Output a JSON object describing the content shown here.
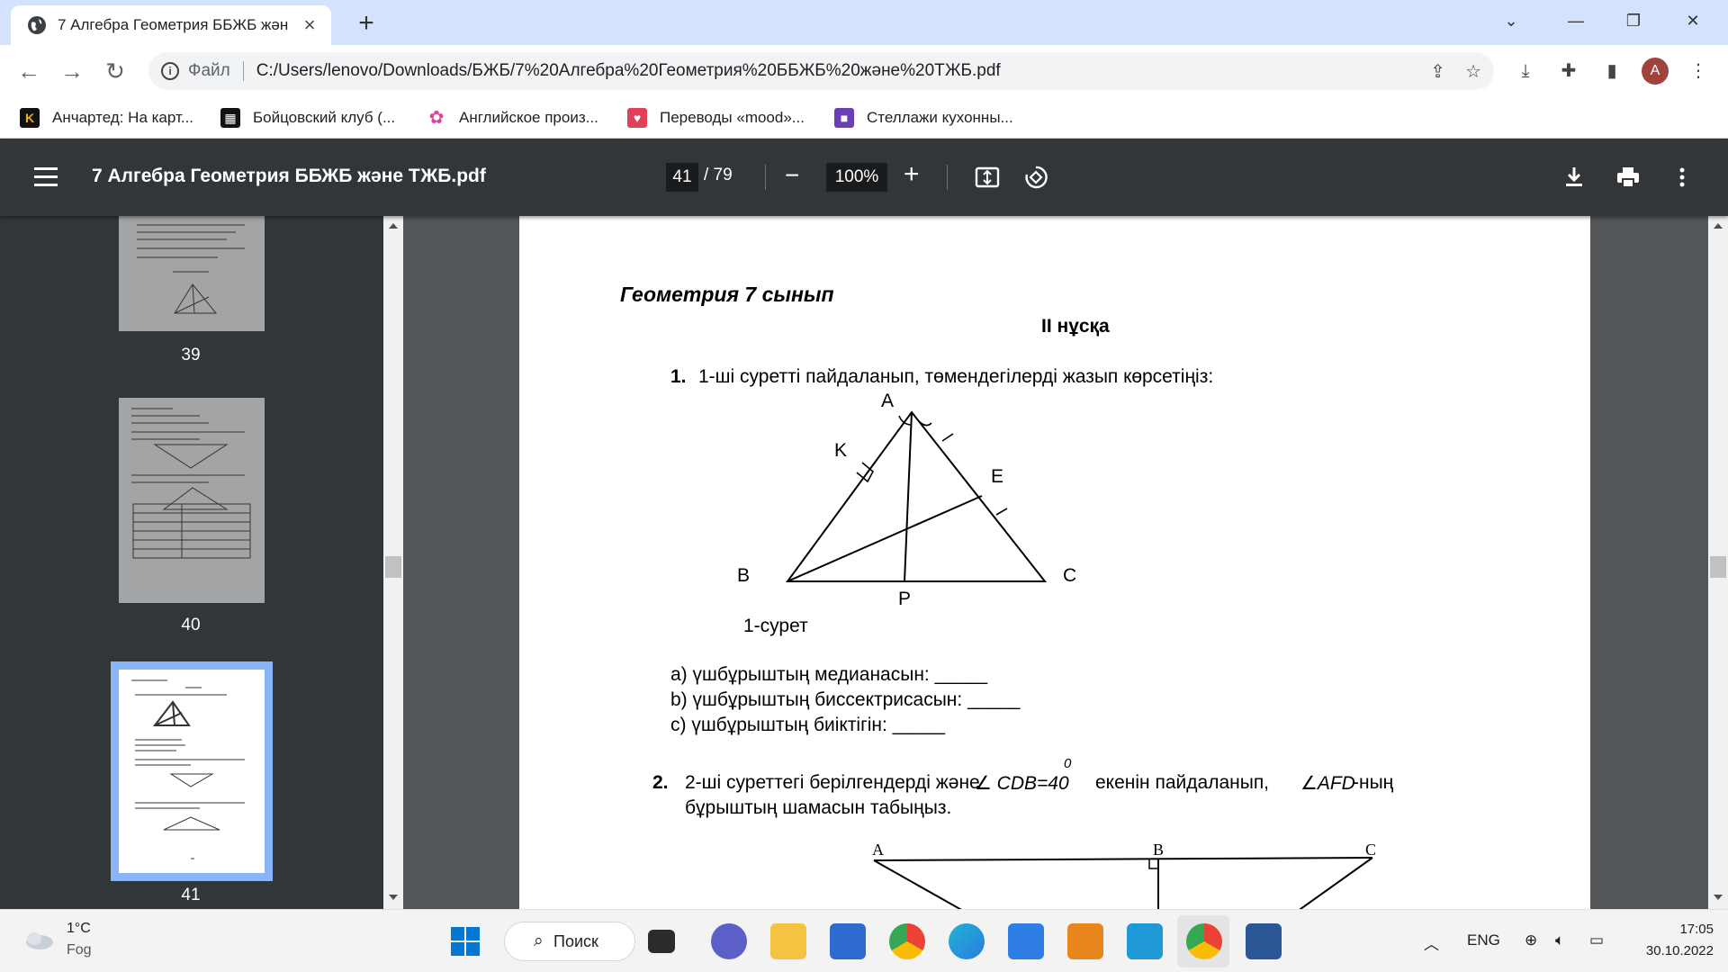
{
  "browser": {
    "tab_title": "7 Алгебра Геометрия ББЖБ жән",
    "url_prefix": "Файл",
    "url": "C:/Users/lenovo/Downloads/БЖБ/7%20Алгебра%20Геометрия%20ББЖБ%20және%20ТЖБ.pdf",
    "avatar_letter": "A",
    "bookmarks": [
      {
        "label": "Анчартед: На карт...",
        "icon": "K",
        "color": "#111111"
      },
      {
        "label": "Бойцовский клуб (...",
        "icon": "film-icon",
        "color": "#111111"
      },
      {
        "label": "Английское произ...",
        "icon": "pinwheel-icon",
        "color": "#e040a0"
      },
      {
        "label": "Переводы «mood»...",
        "icon": "bookmark-red-icon",
        "color": "#e0405a"
      },
      {
        "label": "Стеллажи кухонны...",
        "icon": "square-purple-icon",
        "color": "#6a3fb5"
      }
    ]
  },
  "pdf": {
    "title": "7 Алгебра Геометрия ББЖБ және ТЖБ.pdf",
    "current_page": "41",
    "total_pages": "/ 79",
    "zoom": "100%"
  },
  "sidebar": {
    "thumbnails": [
      {
        "label": "39",
        "selected": false
      },
      {
        "label": "40",
        "selected": false
      },
      {
        "label": "41",
        "selected": true
      }
    ]
  },
  "document": {
    "header": "Геометрия 7 сынып",
    "variant": "II нұсқа",
    "q1_num": "1.",
    "q1_text": "1-ші суретті пайдаланып, төмендегілерді жазып көрсетіңіз:",
    "fig1": {
      "labels": {
        "A": "A",
        "K": "K",
        "E": "E",
        "B": "B",
        "C": "C",
        "P": "P"
      },
      "caption": "1-сурет"
    },
    "q1_items": [
      "а) үшбұрыштың медианасын:  _____",
      "b) үшбұрыштың биссектрисасын:   _____",
      "с) үшбұрыштың биіктігін:  _____"
    ],
    "q2_num": "2.",
    "q2_text_a": "2-ші суреттегі берілгендерді және",
    "q2_angle": "∠ CDB=40",
    "q2_sup": "0",
    "q2_text_b": "екенін пайдаланып,",
    "q2_angle2": "∠AFD",
    "q2_text_c": "-ның",
    "q2_line2": "бұрыштың шамасын табыңыз.",
    "fig2": {
      "labels": {
        "A": "A",
        "B": "B",
        "C": "C"
      }
    }
  },
  "taskbar": {
    "weather_temp": "1°C",
    "weather_desc": "Fog",
    "search_label": "Поиск",
    "lang": "ENG",
    "time": "17:05",
    "date": "30.10.2022"
  }
}
